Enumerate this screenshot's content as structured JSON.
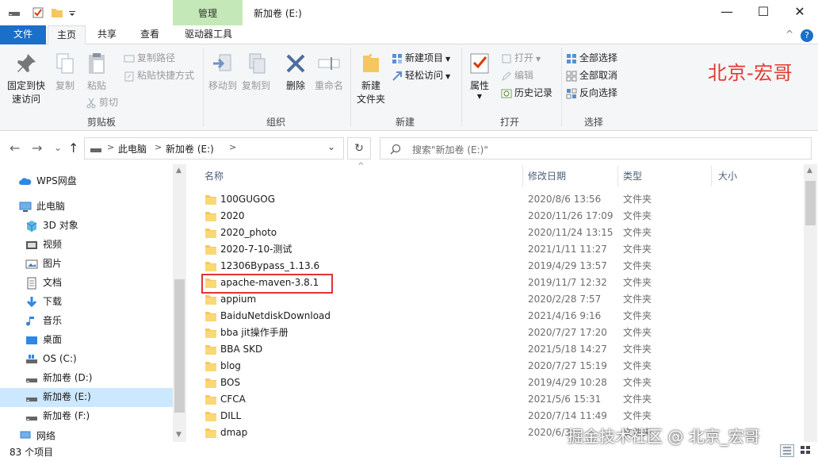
{
  "titlebar": {
    "manage_tab": "管理",
    "title": "新加卷 (E:)",
    "minimize": "—",
    "maximize": "☐",
    "close": "✕"
  },
  "ribbon_tabs": {
    "file": "文件",
    "home": "主页",
    "share": "共享",
    "view": "查看",
    "drive_tools": "驱动器工具",
    "collapse": "^",
    "help": "?"
  },
  "ribbon": {
    "clipboard": {
      "label": "剪贴板",
      "pin": "固定到快\n速访问",
      "pin_l1": "固定到快",
      "pin_l2": "速访问",
      "copy": "复制",
      "paste": "粘贴",
      "copy_path": "复制路径",
      "paste_shortcut": "粘贴快捷方式",
      "cut": "剪切"
    },
    "organize": {
      "label": "组织",
      "move_to": "移动到",
      "copy_to": "复制到",
      "delete": "删除",
      "rename": "重命名"
    },
    "new": {
      "label": "新建",
      "new_folder_l1": "新建",
      "new_folder_l2": "文件夹",
      "new_item": "新建项目",
      "easy_access": "轻松访问"
    },
    "open": {
      "label": "打开",
      "properties": "属性",
      "open": "打开",
      "edit": "编辑",
      "history": "历史记录"
    },
    "select": {
      "label": "选择",
      "select_all": "全部选择",
      "select_none": "全部取消",
      "invert": "反向选择"
    }
  },
  "watermark_top": "北京-宏哥",
  "address": {
    "back": "←",
    "forward": "→",
    "recent": "⌄",
    "up": "↑",
    "crumb_pc": "此电脑",
    "crumb_drive": "新加卷 (E:)",
    "sep": ">",
    "dropdown": "⌄",
    "refresh": "↻",
    "search_placeholder": "搜索\"新加卷 (E:)\""
  },
  "navpane": {
    "items": [
      {
        "label": "WPS网盘",
        "icon": "cloud-icon"
      },
      {
        "label": "此电脑",
        "icon": "computer-icon"
      },
      {
        "label": "3D 对象",
        "icon": "cube-icon"
      },
      {
        "label": "视频",
        "icon": "video-icon"
      },
      {
        "label": "图片",
        "icon": "picture-icon"
      },
      {
        "label": "文档",
        "icon": "document-icon"
      },
      {
        "label": "下载",
        "icon": "download-icon"
      },
      {
        "label": "音乐",
        "icon": "music-icon"
      },
      {
        "label": "桌面",
        "icon": "desktop-icon"
      },
      {
        "label": "OS (C:)",
        "icon": "windows-drive-icon"
      },
      {
        "label": "新加卷 (D:)",
        "icon": "drive-icon"
      },
      {
        "label": "新加卷 (E:)",
        "icon": "drive-icon"
      },
      {
        "label": "新加卷 (F:)",
        "icon": "drive-icon"
      },
      {
        "label": "网络",
        "icon": "network-icon"
      }
    ]
  },
  "columns": {
    "name": "名称",
    "date": "修改日期",
    "type": "类型",
    "size": "大小"
  },
  "files": [
    {
      "name": "100GUGOG",
      "date": "2020/8/6 13:56",
      "type": "文件夹"
    },
    {
      "name": "2020",
      "date": "2020/11/26 17:09",
      "type": "文件夹"
    },
    {
      "name": "2020_photo",
      "date": "2020/11/24 13:15",
      "type": "文件夹"
    },
    {
      "name": "2020-7-10-测试",
      "date": "2021/1/11 11:27",
      "type": "文件夹"
    },
    {
      "name": "12306Bypass_1.13.6",
      "date": "2019/4/29 13:57",
      "type": "文件夹"
    },
    {
      "name": "apache-maven-3.8.1",
      "date": "2019/11/7 12:32",
      "type": "文件夹"
    },
    {
      "name": "appium",
      "date": "2020/2/28 7:57",
      "type": "文件夹"
    },
    {
      "name": "BaiduNetdiskDownload",
      "date": "2021/4/16 9:16",
      "type": "文件夹"
    },
    {
      "name": "bba jit操作手册",
      "date": "2020/7/27 17:20",
      "type": "文件夹"
    },
    {
      "name": "BBA SKD",
      "date": "2021/5/18 14:27",
      "type": "文件夹"
    },
    {
      "name": "blog",
      "date": "2020/7/27 15:19",
      "type": "文件夹"
    },
    {
      "name": "BOS",
      "date": "2019/4/29 10:28",
      "type": "文件夹"
    },
    {
      "name": "CFCA",
      "date": "2021/5/6 15:31",
      "type": "文件夹"
    },
    {
      "name": "DILL",
      "date": "2020/7/14 11:49",
      "type": "文件夹"
    },
    {
      "name": "dmap",
      "date": "2020/6/3",
      "type": "文件夹"
    }
  ],
  "status": {
    "count": "83 个项目"
  },
  "watermark_bottom": "掘金技术社区 @ 北京_宏哥",
  "colors": {
    "file_tab": "#1a6fc9",
    "manage_tab": "#c4e8b8",
    "selected": "#cce8ff",
    "highlight": "#e03434",
    "folder": "#f6c760"
  }
}
